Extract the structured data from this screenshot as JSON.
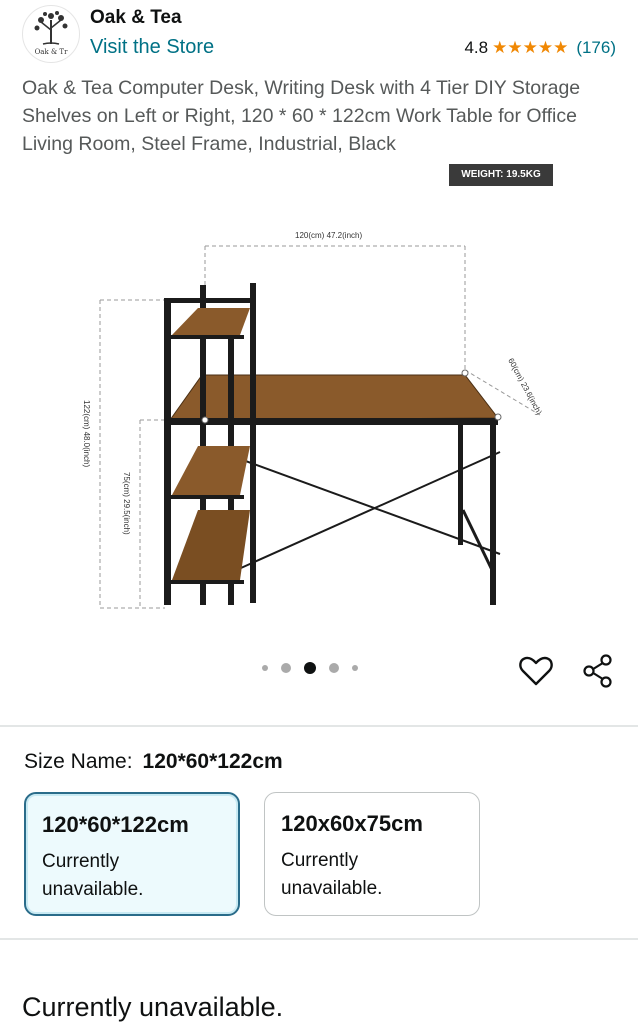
{
  "store": {
    "name": "Oak & Tea",
    "logo_text": "Oak & Tr",
    "visit_link": "Visit the Store",
    "rating": "4.8",
    "stars": "★★★★★",
    "rating_count": "(176)"
  },
  "product": {
    "title": "Oak & Tea Computer Desk, Writing Desk with 4 Tier DIY Storage Shelves on Left or Right, 120 * 60 * 122cm Work Table for Office Living Room, Steel Frame, Industrial, Black",
    "weight_badge": "WEIGHT: 19.5KG",
    "dimension_labels": {
      "width": "120(cm) 47.2(inch)",
      "depth": "60(cm) 23.6(inch)",
      "height": "122(cm) 48.0(inch)",
      "desk_height": "75(cm) 29.5(inch)"
    },
    "image_count": 5,
    "active_image_index": 2
  },
  "icons": {
    "wishlist": "heart-icon",
    "share": "share-icon"
  },
  "size": {
    "label": "Size Name:",
    "selected_value": "120*60*122cm",
    "options": [
      {
        "name": "120*60*122cm",
        "status": "Currently unavailable.",
        "selected": true
      },
      {
        "name": "120x60x75cm",
        "status": "Currently unavailable.",
        "selected": false
      }
    ]
  },
  "availability": "Currently unavailable.",
  "colors": {
    "link": "#007185",
    "star": "#f08804",
    "selected_border": "#2a6c8a",
    "selected_bg": "#edfafd",
    "wood": "#8a5a2b"
  }
}
